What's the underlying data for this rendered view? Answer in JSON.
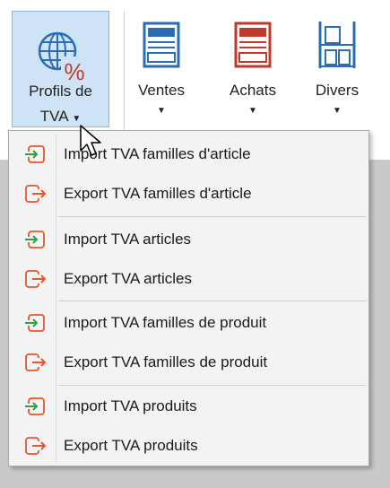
{
  "ribbon": {
    "profils": {
      "label_line1": "Profils de",
      "label_line2": "TVA",
      "arrow": "▼",
      "icon": "globe-percent-icon"
    },
    "ventes": {
      "label": "Ventes",
      "arrow": "▼",
      "icon": "sales-document-icon"
    },
    "achats": {
      "label": "Achats",
      "arrow": "▼",
      "icon": "purchase-document-icon"
    },
    "divers": {
      "label": "Divers",
      "arrow": "▼",
      "icon": "shelves-icon"
    }
  },
  "menu": {
    "items": [
      {
        "label": "Import TVA familles d'article",
        "icon": "import-icon"
      },
      {
        "label": "Export TVA familles d'article",
        "icon": "export-icon"
      },
      {
        "label": "Import TVA articles",
        "icon": "import-icon"
      },
      {
        "label": "Export TVA articles",
        "icon": "export-icon"
      },
      {
        "label": "Import TVA familles de produit",
        "icon": "import-icon"
      },
      {
        "label": "Export TVA familles de produit",
        "icon": "export-icon"
      },
      {
        "label": "Import TVA produits",
        "icon": "import-icon"
      },
      {
        "label": "Export TVA produits",
        "icon": "export-icon"
      }
    ]
  },
  "colors": {
    "accent": "#cfe3f6",
    "import": "#2e9e3f",
    "export": "#e8572a",
    "icon_blue": "#2a6db5",
    "icon_red": "#c0392b"
  }
}
